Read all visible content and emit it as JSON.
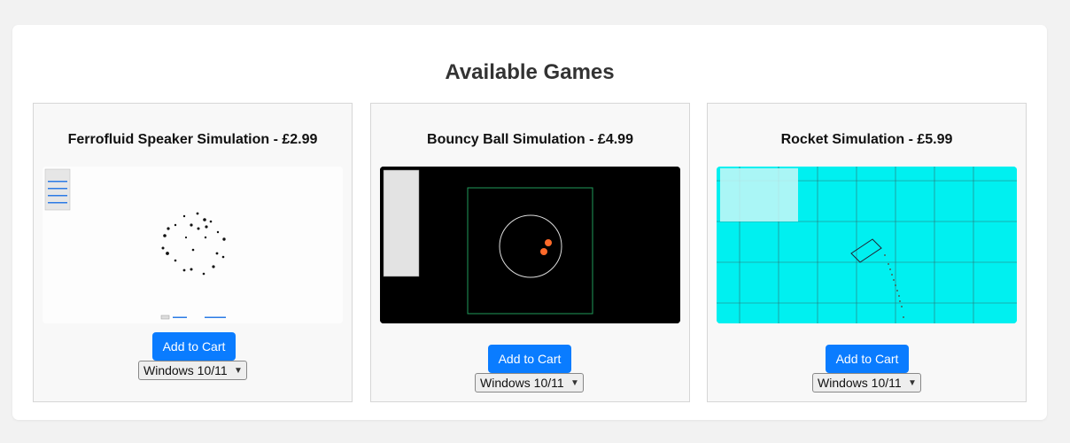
{
  "page": {
    "title": "Available Games"
  },
  "products": [
    {
      "title": "Ferrofluid Speaker Simulation - £2.99",
      "button_label": "Add to Cart",
      "platform": "Windows 10/11"
    },
    {
      "title": "Bouncy Ball Simulation - £4.99",
      "button_label": "Add to Cart",
      "platform": "Windows 10/11"
    },
    {
      "title": "Rocket Simulation - £5.99",
      "button_label": "Add to Cart",
      "platform": "Windows 10/11"
    }
  ],
  "colors": {
    "accent": "#0a7cff",
    "rocket_bg": "#00f0f0",
    "bouncy_bg": "#000000",
    "ball": "#ff6a2a"
  },
  "icons": {
    "dropdown": "chevron-down-icon"
  }
}
